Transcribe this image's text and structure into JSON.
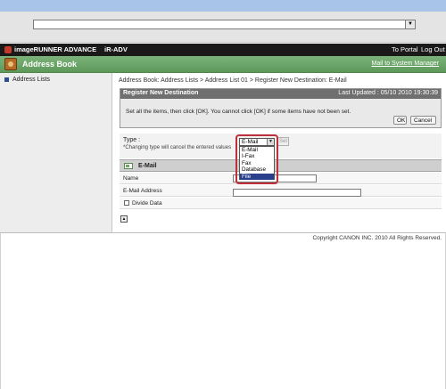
{
  "header": {
    "brand": "imageRUNNER ADVANCE",
    "model": "iR-ADV",
    "to_portal": "To Portal",
    "log_out": "Log Out"
  },
  "title_bar": {
    "title": "Address Book",
    "mail_link": "Mail to System Manager"
  },
  "sidebar": {
    "items": [
      {
        "label": "Address Lists"
      }
    ]
  },
  "breadcrumb": "Address Book: Address Lists > Address List 01 > Register New Destination: E-Mail",
  "panel": {
    "title": "Register New Destination",
    "last_updated": "Last Updated : 05/10 2010 19:30:39",
    "message": "Set all the items, then click [OK]. You cannot click [OK] if some items have not been set.",
    "ok": "OK",
    "cancel": "Cancel"
  },
  "type_section": {
    "label": "Type :",
    "note": "*Changing type will cancel the entered values",
    "set_button": "Set",
    "selected": "E-Mail",
    "options": [
      "E-Mail",
      "I-Fax",
      "Fax",
      "Database",
      "File"
    ],
    "highlighted_option": "File"
  },
  "email_section": {
    "title": "E-Mail",
    "name_label": "Name",
    "email_label": "E-Mail Address",
    "divide_label": "Divide Data",
    "name_value": "",
    "email_value": ""
  },
  "footer": {
    "copyright": "Copyright CANON INC. 2010 All Rights Reserved."
  },
  "colors": {
    "title_bar": "#6aa567",
    "header_bg": "#1a1a1a",
    "highlight": "#c0303a",
    "selected_option": "#2a3f8c"
  }
}
